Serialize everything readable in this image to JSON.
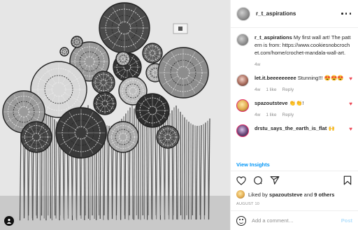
{
  "post": {
    "author": "r_t_aspirations",
    "caption_author": "r_t_aspirations",
    "caption_text": "My first wall art! The pattern is from: https://www.cookiesnobcrochet.com/home/crochet-mandala-wall-art.",
    "caption_time": "4w"
  },
  "comments": [
    {
      "user": "let.it.beeeeeeeee",
      "text": "Stunning!!! 😍😍😍",
      "time": "4w",
      "likes": "1 like",
      "reply": "Reply"
    },
    {
      "user": "spazoutsteve",
      "text": "👏👏!",
      "time": "4w",
      "likes": "1 like",
      "reply": "Reply"
    },
    {
      "user": "drstu_says_the_earth_is_flat",
      "text": "🙌",
      "time": "",
      "likes": "",
      "reply": ""
    }
  ],
  "insights_label": "View Insights",
  "likes": {
    "liked_by": "Liked by",
    "user": "spazoutsteve",
    "and": "and",
    "others": "9 others"
  },
  "date": "AUGUST 10",
  "add_comment": {
    "placeholder": "Add a comment…",
    "post_label": "Post"
  },
  "icons": [
    "more-icon",
    "heart-icon",
    "comment-icon",
    "share-icon",
    "bookmark-icon",
    "emoji-icon",
    "user-tag-icon"
  ],
  "colors": {
    "link": "#0095f6",
    "heart": "#ed4956",
    "post_disabled": "#b2dffc",
    "muted": "#8e8e8e"
  }
}
